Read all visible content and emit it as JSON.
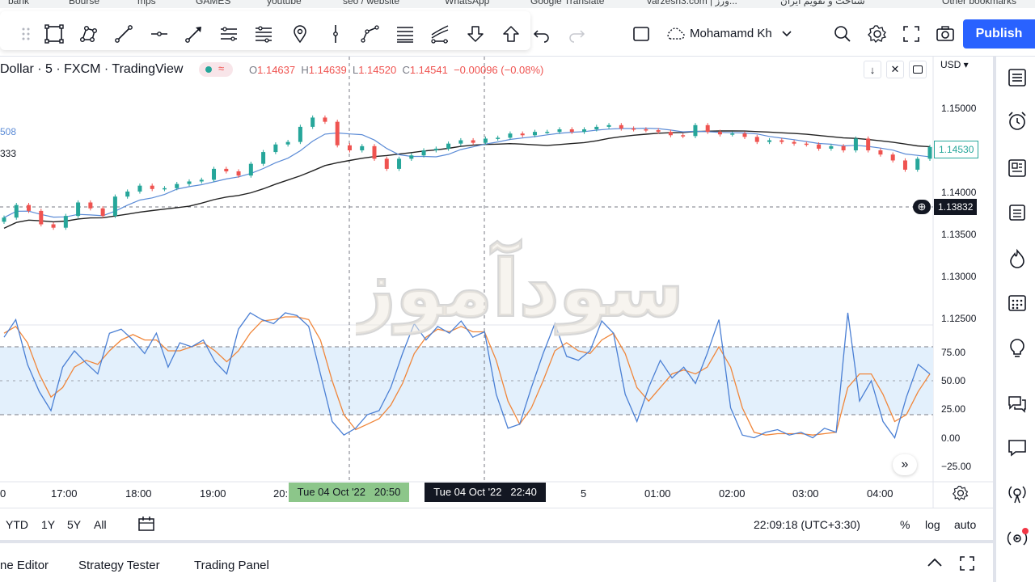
{
  "bookmarks": [
    "bank",
    "Bourse",
    "mps",
    "GAMES",
    "youtube",
    "seo / website",
    "WhatsApp",
    "Google Translate",
    "varzesh3.com | ورز...",
    "شناخت و تقویم ایران",
    "Other bookmarks"
  ],
  "toolbar": {
    "user_name": "Mohamamd Kh",
    "publish_label": "Publish",
    "drawing_tools": [
      "drag-handle-icon",
      "rectangle-select-icon",
      "node-icon",
      "trend-line-icon",
      "horizontal-ray-icon",
      "arrow-line-icon",
      "fib-icon",
      "channel-icon",
      "pin-icon",
      "vertical-line-icon",
      "path-icon",
      "gann-icon",
      "pitchfork-icon",
      "arrow-down-icon",
      "arrow-up-icon"
    ]
  },
  "chart_header": {
    "symbol": "Dollar · 5 · FXCM · TradingView",
    "open_label": "O",
    "open": "1.14637",
    "high_label": "H",
    "high": "1.14639",
    "low_label": "L",
    "low": "1.14520",
    "close_label": "C",
    "close": "1.14541",
    "change": "−0.00096 (−0.08%)",
    "ma1_value": "508",
    "ma2_value": "333",
    "currency": "USD"
  },
  "price_axis": {
    "ticks": [
      "1.15000",
      "1.14000",
      "1.13500",
      "1.13000",
      "1.12500"
    ],
    "current_price": "1.14530",
    "crosshair_price": "1.13832"
  },
  "osc_axis": {
    "ticks": [
      "75.00",
      "50.00",
      "25.00",
      "0.00",
      "−25.00"
    ]
  },
  "time_axis": {
    "ticks": [
      "0",
      "17:00",
      "18:00",
      "19:00",
      "20:",
      "5",
      "01:00",
      "02:00",
      "03:00",
      "04:00"
    ],
    "marker_green": "Tue 04 Oct '22   20:50",
    "marker_dark": "Tue 04 Oct '22   22:40"
  },
  "range_bar": {
    "ranges": [
      "YTD",
      "1Y",
      "5Y",
      "All"
    ],
    "clock": "22:09:18 (UTC+3:30)",
    "percent": "%",
    "log": "log",
    "auto": "auto"
  },
  "bottom_tabs": [
    "ne Editor",
    "Strategy Tester",
    "Trading Panel"
  ],
  "watermark": "سودآموز",
  "colors": {
    "accent": "#2962ff",
    "up": "#26a69a",
    "down": "#ef5350",
    "ma_blue": "#5b8bd6",
    "ma_black": "#222222",
    "stoch_k": "#4a7fd4",
    "stoch_d": "#f0863a",
    "band_fill": "#e3f0fc"
  },
  "chart_data": {
    "type": "candlestick",
    "y_range": [
      1.12,
      1.155
    ],
    "osc_range": [
      -30,
      100
    ],
    "candles_close": [
      1.137,
      1.1385,
      1.1378,
      1.1362,
      1.1358,
      1.1372,
      1.1388,
      1.1381,
      1.1372,
      1.1395,
      1.1401,
      1.1408,
      1.1404,
      1.1405,
      1.141,
      1.1413,
      1.1415,
      1.1428,
      1.1425,
      1.142,
      1.1434,
      1.1448,
      1.1457,
      1.146,
      1.1478,
      1.1489,
      1.1484,
      1.1456,
      1.145,
      1.1455,
      1.144,
      1.1428,
      1.144,
      1.1444,
      1.145,
      1.1452,
      1.1458,
      1.1462,
      1.1459,
      1.1464,
      1.1465,
      1.147,
      1.1468,
      1.1472,
      1.1472,
      1.1475,
      1.1472,
      1.1475,
      1.1478,
      1.148,
      1.1476,
      1.1475,
      1.1474,
      1.1472,
      1.1468,
      1.1467,
      1.148,
      1.1472,
      1.1469,
      1.147,
      1.1466,
      1.146,
      1.1462,
      1.146,
      1.1458,
      1.1457,
      1.1452,
      1.1455,
      1.145,
      1.1464,
      1.145,
      1.1445,
      1.1438,
      1.1427,
      1.144,
      1.1454
    ],
    "stoch_k": [
      82,
      95,
      62,
      42,
      28,
      60,
      72,
      63,
      55,
      85,
      88,
      80,
      70,
      85,
      60,
      78,
      75,
      80,
      64,
      55,
      88,
      100,
      95,
      92,
      100,
      98,
      90,
      55,
      20,
      10,
      15,
      25,
      28,
      45,
      70,
      92,
      80,
      90,
      85,
      94,
      82,
      86,
      40,
      15,
      18,
      45,
      70,
      92,
      68,
      65,
      72,
      94,
      85,
      40,
      20,
      45,
      65,
      52,
      60,
      48,
      70,
      95,
      30,
      10,
      8,
      12,
      14,
      10,
      12,
      8,
      15,
      12,
      100,
      35,
      50,
      20,
      8,
      38,
      62,
      55
    ],
    "stoch_d": [
      85,
      90,
      78,
      55,
      38,
      45,
      60,
      65,
      62,
      72,
      80,
      84,
      80,
      80,
      72,
      72,
      75,
      78,
      72,
      64,
      72,
      85,
      94,
      95,
      97,
      97,
      95,
      80,
      50,
      25,
      14,
      18,
      22,
      32,
      48,
      70,
      82,
      88,
      86,
      90,
      86,
      86,
      65,
      35,
      18,
      30,
      50,
      72,
      78,
      72,
      70,
      80,
      85,
      70,
      45,
      35,
      45,
      55,
      58,
      55,
      60,
      75,
      60,
      30,
      12,
      10,
      11,
      11,
      11,
      10,
      11,
      12,
      45,
      55,
      55,
      40,
      20,
      25,
      42,
      55
    ]
  }
}
